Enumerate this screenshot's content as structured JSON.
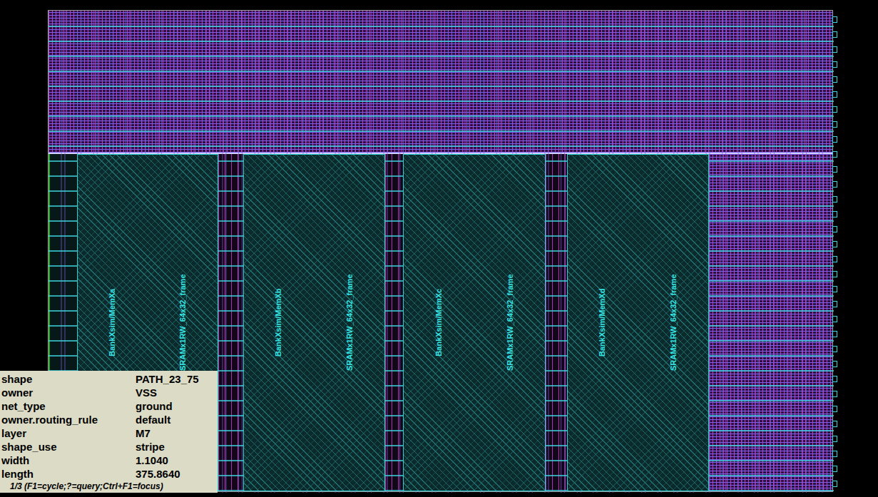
{
  "viewer": {
    "macros": [
      {
        "labels": [
          "BankXsim/MemXa",
          "SRAMx1RW_64x32_frame"
        ]
      },
      {
        "labels": [
          "BankXsim/MemXb",
          "SRAMx1RW_64x32_frame"
        ]
      },
      {
        "labels": [
          "BankXsim/MemXc",
          "SRAMx1RW_64x32_frame"
        ]
      },
      {
        "labels": [
          "BankXsim/MemXd",
          "SRAMx1RW_64x32_frame"
        ]
      }
    ]
  },
  "inspector": {
    "rows": [
      {
        "key": "shape",
        "value": "PATH_23_75"
      },
      {
        "key": "owner",
        "value": "VSS"
      },
      {
        "key": "net_type",
        "value": "ground"
      },
      {
        "key": "owner.routing_rule",
        "value": "default"
      },
      {
        "key": "layer",
        "value": "M7"
      },
      {
        "key": "shape_use",
        "value": "stripe"
      },
      {
        "key": "width",
        "value": "1.1040"
      },
      {
        "key": "length",
        "value": "375.8640"
      }
    ],
    "footer": "1/3 (F1=cycle;?=query;Ctrl+F1=focus)"
  }
}
